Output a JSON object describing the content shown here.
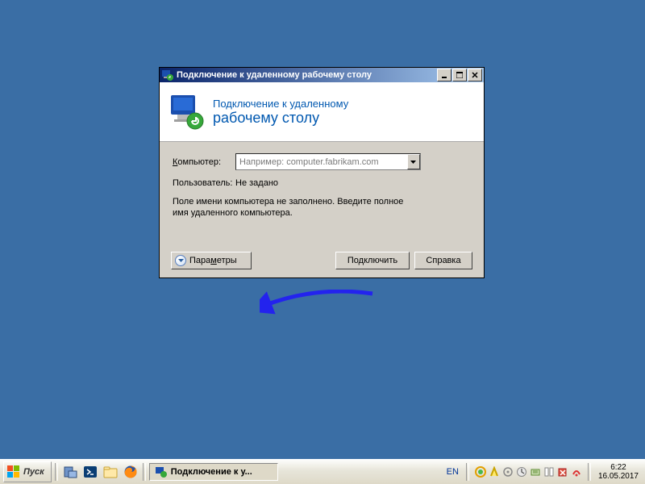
{
  "dialog": {
    "title": "Подключение к удаленному рабочему столу",
    "banner_line1": "Подключение к удаленному",
    "banner_line2": "рабочему столу",
    "computer_label_pre": "К",
    "computer_label_post": "омпьютер:",
    "computer_placeholder": "Например: computer.fabrikam.com",
    "user_label": "Пользователь:",
    "user_value": "Не задано",
    "hint": "Поле имени компьютера не заполнено. Введите полное имя удаленного компьютера.",
    "options_btn_pre": "Пара",
    "options_btn_ul": "м",
    "options_btn_post": "етры",
    "connect_btn_pre": "Подкл",
    "connect_btn_ul": "ю",
    "connect_btn_post": "чить",
    "help_btn": "Справка"
  },
  "taskbar": {
    "start": "Пуск",
    "active_task": "Подключение к у...",
    "lang": "EN",
    "time": "6:22",
    "date": "16.05.2017"
  }
}
